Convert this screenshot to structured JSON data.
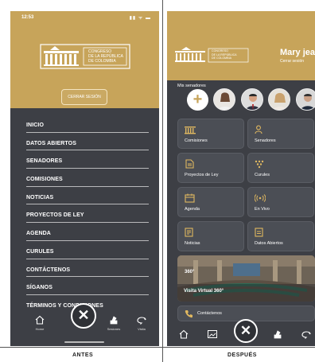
{
  "left": {
    "status_time": "12:53",
    "status_icons": "▮▮ ᯤ ▬",
    "logo_lines": [
      "CONGRESO",
      "DE LA REPÚBLICA",
      "DE COLOMBIA"
    ],
    "logout_label": "CERRAR SESIÓN",
    "menu_items": [
      "INICIO",
      "DATOS ABIERTOS",
      "SENADORES",
      "COMISIONES",
      "NOTICIAS",
      "PROYECTOS DE LEY",
      "AGENDA",
      "CURULES",
      "CONTÁCTENOS",
      "SÍGANOS",
      "TÉRMINOS Y CONDICIONES"
    ],
    "nav": {
      "home": "Home",
      "senators": "Sesiones",
      "visit": "Visita"
    },
    "close_glyph": "✕",
    "caption": "ANTES"
  },
  "right": {
    "logo_lines": [
      "CONGRESO",
      "DE LA REPÚBLICA",
      "DE COLOMBIA"
    ],
    "user_name": "Mary jear",
    "user_sub": "Cerrar sesión",
    "senators_label": "Mis senadores",
    "add_glyph": "+",
    "tiles": [
      {
        "label": "Comisiones",
        "icon": "building-icon"
      },
      {
        "label": "Senadores",
        "icon": "person-icon"
      },
      {
        "label": "Proyectos de Ley",
        "icon": "document-icon"
      },
      {
        "label": "Curules",
        "icon": "seats-icon"
      },
      {
        "label": "Agenda",
        "icon": "calendar-icon"
      },
      {
        "label": "En Vivo",
        "icon": "broadcast-icon"
      },
      {
        "label": "Noticias",
        "icon": "news-icon"
      },
      {
        "label": "Datos Abiertos",
        "icon": "data-icon"
      }
    ],
    "tour_label": "Visita Virtual 360°",
    "tour_badge": "360°",
    "contact_label": "Contáctenos",
    "close_glyph": "✕",
    "caption": "DESPUÉS"
  },
  "colors": {
    "gold": "#c7a45a",
    "dark": "#3d3f45",
    "tile": "#4b4e55"
  }
}
